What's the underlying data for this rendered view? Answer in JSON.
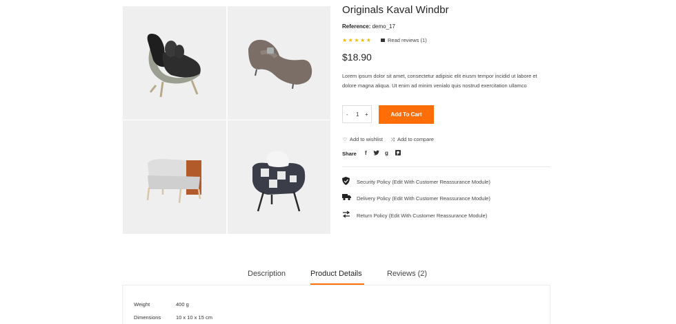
{
  "product": {
    "title": "Originals Kaval Windbr",
    "reference_label": "Reference:",
    "reference_value": "demo_17",
    "stars": "★★★★★",
    "reviews_link": "Read reviews (1)",
    "price": "$18.90",
    "description": "Lorem ipsum dolor sit amet, consectetur adipisic elit eiusm tempor incidid ut labore et dolore magna aliqua. Ut enim ad minim venialo quis nostrud exercitation ullamco"
  },
  "cart": {
    "minus": "-",
    "quantity": "1",
    "plus": "+",
    "add_label": "Add To Cart",
    "accent_color": "#ff6e07"
  },
  "actions": {
    "wishlist": "Add to wishlist",
    "compare": "Add to compare"
  },
  "share": {
    "label": "Share",
    "icons": [
      "f",
      "twitter",
      "g",
      "pinterest"
    ]
  },
  "policies": [
    {
      "icon": "shield-icon",
      "text": "Security Policy (Edit With Customer Reassurance Module)"
    },
    {
      "icon": "truck-icon",
      "text": "Delivery Policy (Edit With Customer Reassurance Module)"
    },
    {
      "icon": "swap-arrows-icon",
      "text": "Return Policy (Edit With Customer Reassurance Module)"
    }
  ],
  "tabs": [
    {
      "label": "Description"
    },
    {
      "label": "Product Details"
    },
    {
      "label": "Reviews (2)"
    }
  ],
  "active_tab": "Product Details",
  "details": [
    {
      "key": "Weight",
      "value": "400 g"
    },
    {
      "key": "Dimensions",
      "value": "10 x 10 x 15 cm"
    }
  ]
}
